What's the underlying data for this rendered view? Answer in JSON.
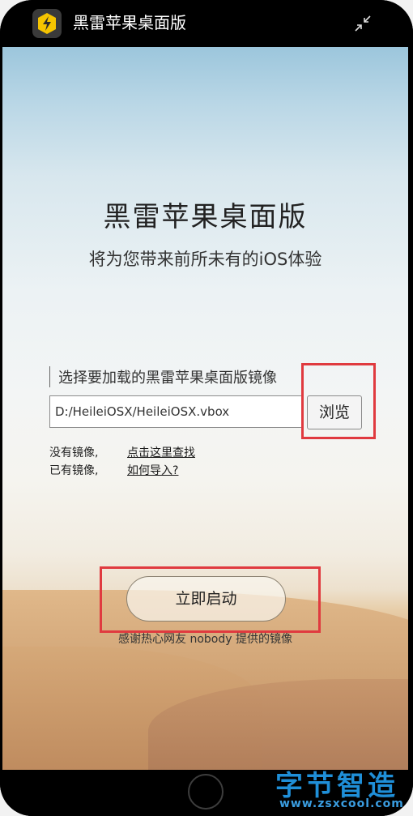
{
  "app": {
    "title": "黑雷苹果桌面版"
  },
  "hero": {
    "title": "黑雷苹果桌面版",
    "subtitle": "将为您带来前所未有的iOS体验"
  },
  "image_select": {
    "label": "选择要加载的黑雷苹果桌面版镜像",
    "path_value": "D:/HeileiOSX/HeileiOSX.vbox",
    "browse_label": "浏览"
  },
  "help": {
    "no_image_label": "没有镜像,",
    "no_image_link": "点击这里查找",
    "has_image_label": "已有镜像,",
    "has_image_link": "如何导入?"
  },
  "launch": {
    "button_label": "立即启动",
    "thanks_text": "感谢热心网友  nobody  提供的镜像"
  },
  "watermark": {
    "title": "字节智造",
    "url": "www.zsxcool.com"
  },
  "colors": {
    "highlight_box": "#e03a3f",
    "logo_yellow": "#f5c400",
    "watermark_blue": "#1f8fd8"
  }
}
